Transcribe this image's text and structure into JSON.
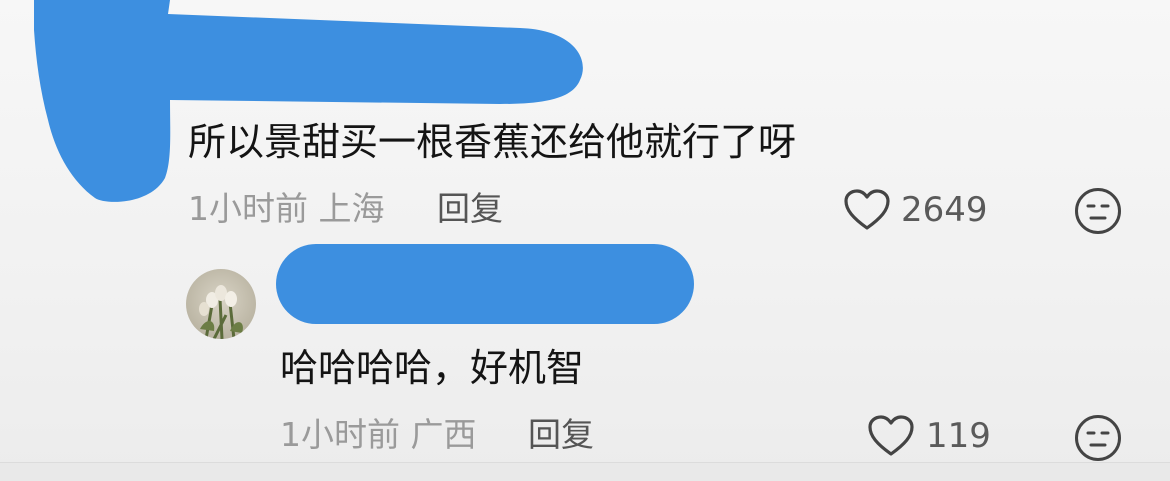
{
  "comments": [
    {
      "text": "所以景甜买一根香蕉还给他就行了呀",
      "meta": "1小时前 上海",
      "reply_label": "回复",
      "likes": "2649"
    },
    {
      "text": "哈哈哈哈，好机智",
      "meta": "1小时前 广西",
      "reply_label": "回复",
      "likes": "119"
    }
  ],
  "icons": {
    "like": "heart-outline-icon",
    "dislike": "neutral-face-icon"
  },
  "colors": {
    "redaction": "#3d8fe0",
    "primary_text": "#141414",
    "meta_text": "#9a9a9a"
  }
}
